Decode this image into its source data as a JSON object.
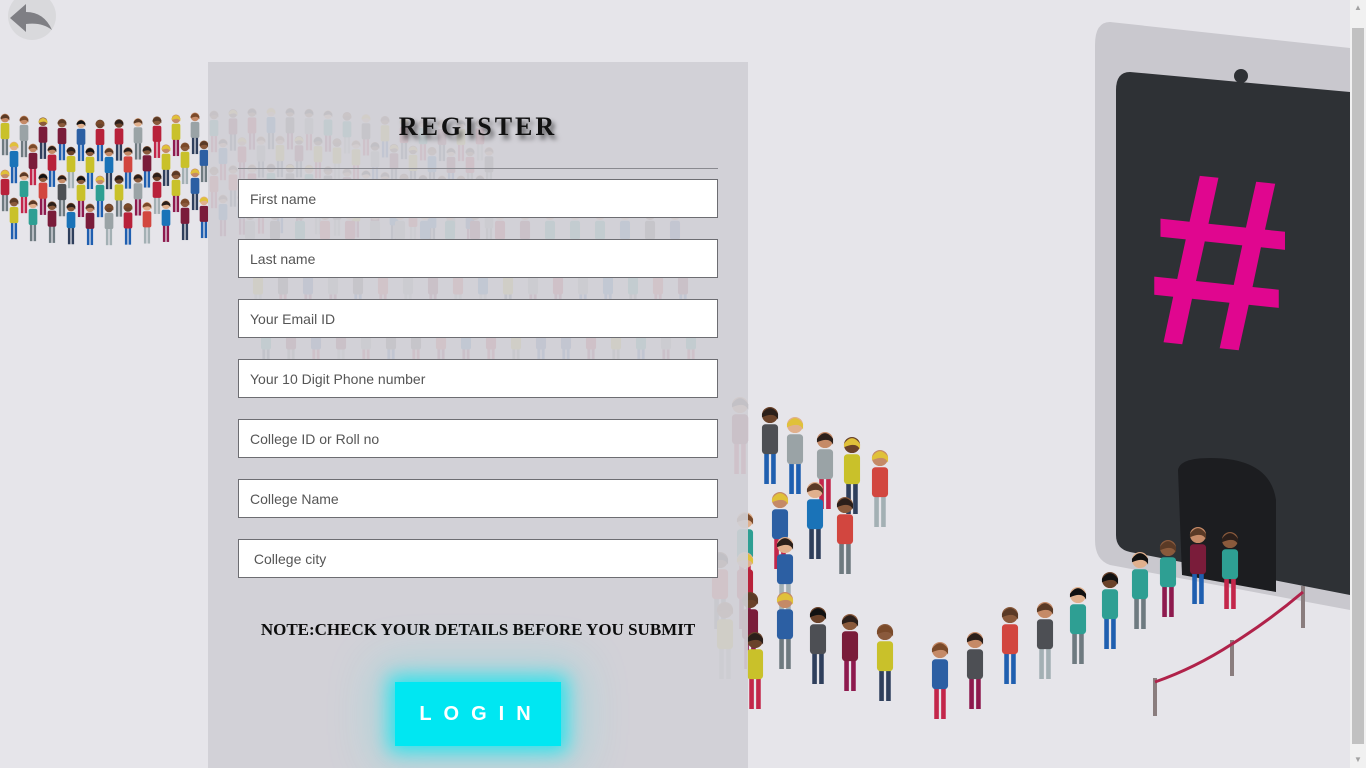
{
  "nav": {
    "back_icon": "back-arrow-icon"
  },
  "form": {
    "title": "REGISTER",
    "fields": [
      {
        "name": "first-name-field",
        "placeholder": "First name"
      },
      {
        "name": "last-name-field",
        "placeholder": "Last name"
      },
      {
        "name": "email-field",
        "placeholder": "Your Email ID"
      },
      {
        "name": "phone-field",
        "placeholder": "Your 10 Digit Phone number"
      },
      {
        "name": "college-id-field",
        "placeholder": "College ID or Roll no"
      },
      {
        "name": "college-name-field",
        "placeholder": "College Name"
      },
      {
        "name": "college-city-field",
        "placeholder": " College city"
      }
    ],
    "note": "NOTE:CHECK YOUR DETAILS BEFORE YOU SUBMIT",
    "submit_label": "LOGIN"
  },
  "illustration": {
    "hashtag": "#",
    "colors": {
      "accent": "#00e7f2",
      "hashtag": "#e0068f",
      "screen": "#2e3135"
    }
  }
}
